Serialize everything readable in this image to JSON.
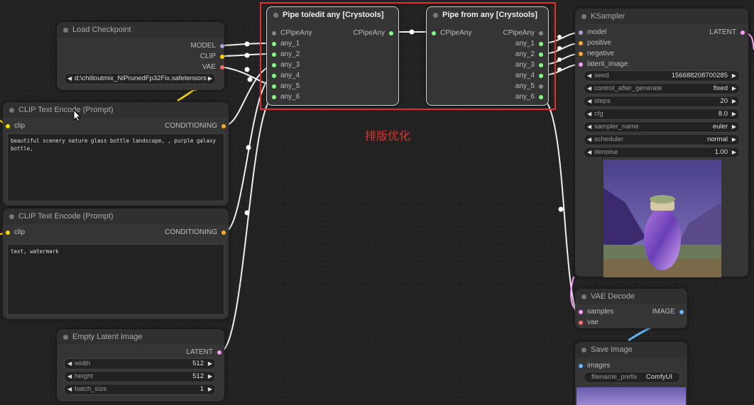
{
  "annotation": "排版优化",
  "nodes": {
    "load_checkpoint": {
      "title": "Load Checkpoint",
      "outputs": [
        "MODEL",
        "CLIP",
        "VAE"
      ],
      "ckpt_value": "d:\\chilloutmix_NiPrunedFp32Fix.safetensors"
    },
    "clip_pos": {
      "title": "CLIP Text Encode (Prompt)",
      "input": "clip",
      "output": "CONDITIONING",
      "text": "beautiful scenery nature glass bottle landscape, , purple galaxy bottle,"
    },
    "clip_neg": {
      "title": "CLIP Text Encode (Prompt)",
      "input": "clip",
      "output": "CONDITIONING",
      "text": "text, watermark"
    },
    "empty_latent": {
      "title": "Empty Latent Image",
      "output": "LATENT",
      "widgets": [
        {
          "label": "width",
          "value": "512"
        },
        {
          "label": "height",
          "value": "512"
        },
        {
          "label": "batch_size",
          "value": "1"
        }
      ]
    },
    "pipe_to": {
      "title": "Pipe to/edit any [Crystools]",
      "input_main": "CPipeAny",
      "output_main": "CPipeAny",
      "inputs": [
        "any_1",
        "any_2",
        "any_3",
        "any_4",
        "any_5",
        "any_6"
      ]
    },
    "pipe_from": {
      "title": "Pipe from any [Crystools]",
      "input_main": "CPipeAny",
      "output_main": "CPipeAny",
      "outputs": [
        "any_1",
        "any_2",
        "any_3",
        "any_4",
        "any_5",
        "any_6"
      ]
    },
    "ksampler": {
      "title": "KSampler",
      "inputs": [
        "model",
        "positive",
        "negative",
        "latent_image"
      ],
      "output": "LATENT",
      "widgets": [
        {
          "label": "seed",
          "value": "156688208700285"
        },
        {
          "label": "control_after_generate",
          "value": "fixed"
        },
        {
          "label": "steps",
          "value": "20"
        },
        {
          "label": "cfg",
          "value": "8.0"
        },
        {
          "label": "sampler_name",
          "value": "euler"
        },
        {
          "label": "scheduler",
          "value": "normal"
        },
        {
          "label": "denoise",
          "value": "1.00"
        }
      ]
    },
    "vae_decode": {
      "title": "VAE Decode",
      "inputs": [
        "samples",
        "vae"
      ],
      "output": "IMAGE"
    },
    "save_image": {
      "title": "Save Image",
      "input": "images",
      "prefix_label": "filename_prefix",
      "prefix_value": "ComfyUI"
    }
  },
  "colors": {
    "model": "#b39ddb",
    "clip": "#ffd500",
    "vae": "#ff6e6e",
    "conditioning": "#ffa931",
    "latent": "#ff9cf9",
    "image": "#64b5f6",
    "any": "#7fff7f",
    "annotation": "#e03030"
  }
}
